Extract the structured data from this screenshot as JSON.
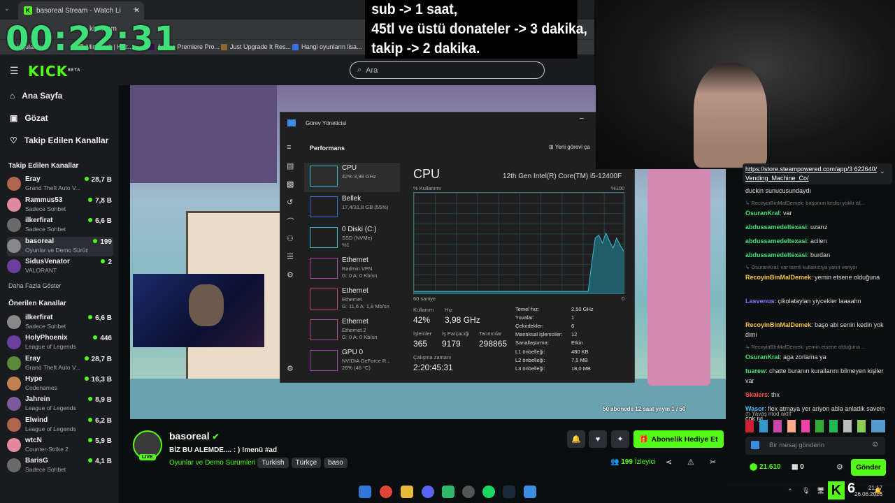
{
  "browser": {
    "tab_title": "basoreal Stream - Watch Li",
    "address": "kick.com",
    "bookmarks": [
      "Uygulamalar",
      "Minecraft | Kaz...",
      "Adobe Premiere Pro...",
      "Just Upgrade It Res...",
      "Hangi oyunların lisa..."
    ]
  },
  "overlay": {
    "timer": "00:22:31",
    "rules": [
      "sub -> 1 saat,",
      "45tl ve üstü donateler -> 3 dakika,",
      "takip -> 2 dakika."
    ]
  },
  "header": {
    "logo": "KICK",
    "logo_badge": "BETA",
    "search_placeholder": "Ara"
  },
  "sidebar": {
    "nav": [
      {
        "label": "Ana Sayfa",
        "icon": "home-icon"
      },
      {
        "label": "Gözat",
        "icon": "browse-icon"
      },
      {
        "label": "Takip Edilen Kanallar",
        "icon": "heart-icon"
      }
    ],
    "followed_title": "Takip Edilen Kanallar",
    "followed": [
      {
        "name": "Eray",
        "game": "Grand Theft Auto V...",
        "viewers": "28,7 B"
      },
      {
        "name": "Rammus53",
        "game": "Sadece Sohbet",
        "viewers": "7,8 B"
      },
      {
        "name": "ilkerfirat",
        "game": "Sadece Sohbet",
        "viewers": "6,6 B"
      },
      {
        "name": "basoreal",
        "game": "Oyunlar ve Demo Sürüml...",
        "viewers": "199"
      },
      {
        "name": "SidusVenator",
        "game": "VALORANT",
        "viewers": "2"
      }
    ],
    "show_more": "Daha Fazla Göster",
    "recommended_title": "Önerilen Kanallar",
    "recommended": [
      {
        "name": "ilkerfirat",
        "game": "Sadece Sohbet",
        "viewers": "6,6 B"
      },
      {
        "name": "HolyPhoenix",
        "game": "League of Legends",
        "viewers": "446"
      },
      {
        "name": "Eray",
        "game": "Grand Theft Auto V...",
        "viewers": "28,7 B"
      },
      {
        "name": "Hype",
        "game": "Codenames",
        "viewers": "16,3 B"
      },
      {
        "name": "Jahrein",
        "game": "League of Legends",
        "viewers": "8,9 B"
      },
      {
        "name": "Elwind",
        "game": "League of Legends",
        "viewers": "6,2 B"
      },
      {
        "name": "wtcN",
        "game": "Counter-Strike 2",
        "viewers": "5,9 B"
      },
      {
        "name": "BarisG",
        "game": "Sadece Sohbet",
        "viewers": "4,1 B"
      }
    ]
  },
  "player": {
    "sub_goal": "50 abonede 12 saat yayın 1 / 50"
  },
  "task_manager": {
    "title": "Görev Yöneticisi",
    "section": "Performans",
    "new_task": "Yeni görevi ça",
    "items": [
      {
        "name": "CPU",
        "detail": "42% 3,98 GHz"
      },
      {
        "name": "Bellek",
        "detail": "17,4/31,8 GB (55%)"
      },
      {
        "name": "0 Diski (C:)",
        "detail": "SSD (NVMe)\n%1"
      },
      {
        "name": "Ethernet",
        "detail": "Radmin VPN\nG: 0 A: 0 Kb/sn"
      },
      {
        "name": "Ethernet",
        "detail": "Ethernet\nG: 11,6 A: 1,8 Mb/sn"
      },
      {
        "name": "Ethernet",
        "detail": "Ethernet 2\nG: 0 A: 0 Kb/sn"
      },
      {
        "name": "GPU 0",
        "detail": "NVIDIA GeForce R...\n26% (46 °C)"
      }
    ],
    "heading": "CPU",
    "model": "12th Gen Intel(R) Core(TM) i5-12400F",
    "usage_label": "% Kullanımı",
    "usage_max": "%100",
    "time_label": "60 saniye",
    "time_end": "0",
    "usage_history_percent": [
      2,
      2,
      2,
      2,
      2,
      2,
      2,
      2,
      2,
      2,
      2,
      2,
      2,
      2,
      2,
      2,
      2,
      2,
      2,
      2,
      2,
      2,
      2,
      2,
      2,
      2,
      2,
      2,
      2,
      2,
      2,
      2,
      2,
      2,
      2,
      2,
      2,
      2,
      2,
      2,
      2,
      2,
      2,
      2,
      2,
      2,
      2,
      2,
      2,
      2,
      30,
      55,
      58,
      50,
      60,
      52,
      45,
      55,
      48,
      42
    ],
    "stats": {
      "usage_label": "Kullanım",
      "usage": "42%",
      "speed_label": "Hız",
      "speed": "3,98 GHz",
      "processes_label": "İşlemler",
      "processes": "365",
      "threads_label": "İş Parçacığı",
      "threads": "9179",
      "handles_label": "Tanıtıcılar",
      "handles": "298865",
      "uptime_label": "Çalışma zamanı",
      "uptime": "2:20:45:31"
    },
    "specs": [
      {
        "k": "Temel hız:",
        "v": "2,50 GHz"
      },
      {
        "k": "Yuvalar:",
        "v": "1"
      },
      {
        "k": "Çekirdekler:",
        "v": "6"
      },
      {
        "k": "Mantıksal işlemciler:",
        "v": "12"
      },
      {
        "k": "Sanallaştırma:",
        "v": "Etkin"
      },
      {
        "k": "L1 önbelleği:",
        "v": "480 KB"
      },
      {
        "k": "L2 önbelleği:",
        "v": "7,5 MB"
      },
      {
        "k": "L3 önbelleği:",
        "v": "18,0 MB"
      }
    ]
  },
  "stream": {
    "channel": "basoreal",
    "live": "LIVE",
    "title": "BİZ BU ALEMDE.... : ) !menü #ad",
    "category": "Oyunlar ve Demo Sürümleri",
    "tags": [
      "Turkish",
      "Türkçe",
      "baso"
    ],
    "gift_button": "Abonelik Hediye Et",
    "viewers": "199",
    "viewers_label": "İzleyici"
  },
  "chat": {
    "link": "https://store.steampowered.com/app/3 622640/Vending_Machine_Co/",
    "messages": [
      {
        "reply": "",
        "user": "",
        "color": "#ddd",
        "text": "duckin sunucusundaydı"
      },
      {
        "reply": "RecoyinBinMalDemek: başonun kedisi yokki isl...",
        "user": "OsuranKral",
        "color": "#3fe07a",
        "text": "var"
      },
      {
        "reply": "",
        "user": "abdussamedeltexasi",
        "color": "#3fe07a",
        "text": "uzarız"
      },
      {
        "reply": "",
        "user": "abdussamedeltexasi",
        "color": "#3fe07a",
        "text": "acilen"
      },
      {
        "reply": "",
        "user": "abdussamedeltexasi",
        "color": "#3fe07a",
        "text": "burdan"
      },
      {
        "reply": "OsuranKral: var isimli kullanıcıya yanıt veriyor",
        "user": "RecoyinBinMalDemek",
        "color": "#f6c343",
        "text": "yemin etsene olduğuna"
      },
      {
        "reply": "",
        "user": "Lasvenus",
        "color": "#7b7bff",
        "text": "çikolataylan yiycekler laaaahn"
      },
      {
        "reply": "",
        "user": "RecoyinBinMalDemek",
        "color": "#f6c343",
        "text": "başo abi senin kedin yok dimi"
      },
      {
        "reply": "RecoyinBinMalDemek: yemin etsene olduğuna ...",
        "user": "OsuranKral",
        "color": "#3fe07a",
        "text": "aga zorlama ya"
      },
      {
        "reply": "",
        "user": "tuarew",
        "color": "#3fe07a",
        "text": "chatte buranın kurallarını bilmeyen kişiler var"
      },
      {
        "reply": "",
        "user": "Skalers",
        "color": "#ff4d4d",
        "text": "thx"
      },
      {
        "reply": "",
        "user": "Wasor",
        "color": "#3fbfff",
        "text": "flex atmaya yer ariyon abla anladik savein cok iyi"
      }
    ],
    "slow_mode": "Yavaş mod aktif",
    "input_placeholder": "Bir mesaj gönderin",
    "points": "21.610",
    "gifts": "0",
    "send_label": "Gönder"
  },
  "taskbar": {
    "clock_time": "21:17",
    "clock_date": "26.06.2026"
  },
  "colors": {
    "kick_green": "#53fc18",
    "timer_green": "#3fe07a"
  }
}
